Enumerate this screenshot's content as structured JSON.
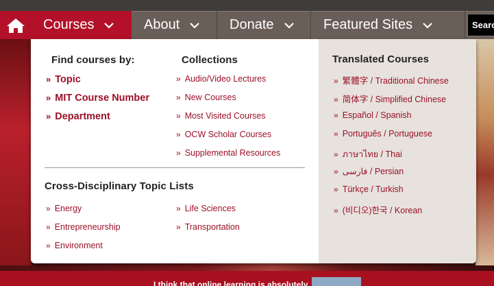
{
  "nav": {
    "home_icon": "home-icon",
    "items": [
      {
        "label": "Courses"
      },
      {
        "label": "About"
      },
      {
        "label": "Donate"
      },
      {
        "label": "Featured Sites"
      }
    ],
    "search_label": "Search"
  },
  "dropdown": {
    "find_by": {
      "heading": "Find courses by:",
      "links": [
        "Topic",
        "MIT Course Number",
        "Department"
      ]
    },
    "collections": {
      "heading": "Collections",
      "links": [
        "Audio/Video Lectures",
        "New Courses",
        "Most Visited Courses",
        "OCW Scholar Courses",
        "Supplemental Resources"
      ]
    },
    "cross": {
      "heading": "Cross-Disciplinary Topic Lists",
      "col1": [
        "Energy",
        "Entrepreneurship",
        "Environment"
      ],
      "col2": [
        "Life Sciences",
        "Transportation"
      ]
    },
    "translated": {
      "heading": "Translated Courses",
      "links": [
        "繁體字 / Traditional Chinese",
        "简体字 / Simplified Chinese",
        "Español / Spanish",
        "Português / Portuguese",
        "ภาษาไทย / Thai",
        "فارسی / Persian",
        "Türkçe / Turkish",
        "(비디오)한국 / Korean"
      ]
    },
    "bullet": "»"
  },
  "background": {
    "bottom_text": "I think that online learning is absolutely"
  },
  "colors": {
    "accent": "#b3102a",
    "link": "#9c1028",
    "nav_bg": "#6a5e58",
    "panel_bg": "#e7e2dd"
  }
}
